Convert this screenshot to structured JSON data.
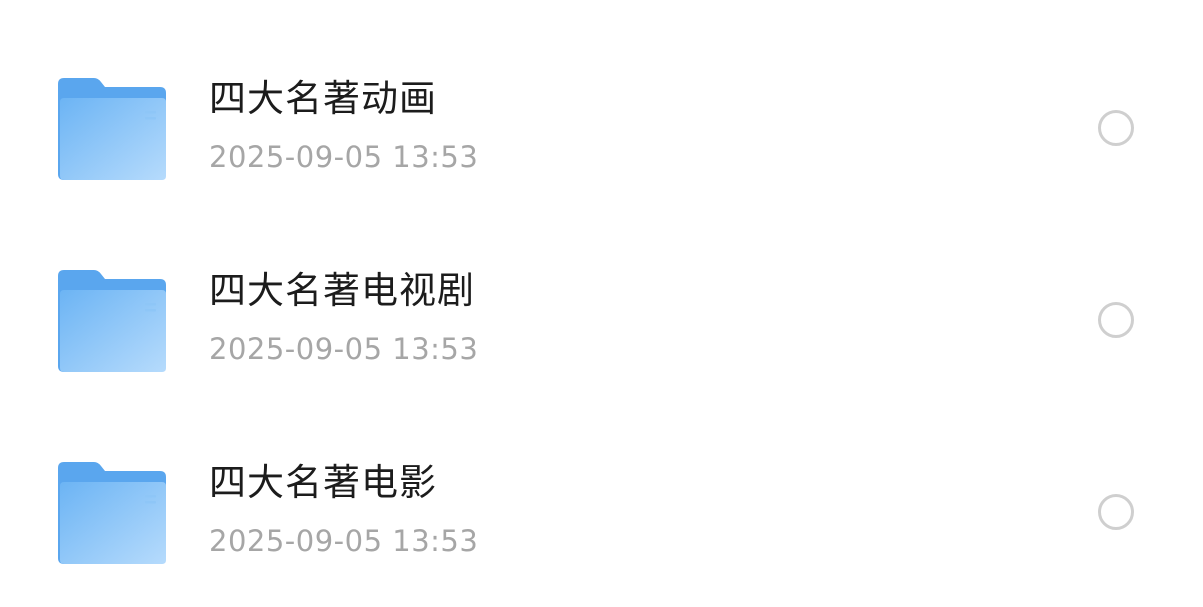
{
  "file_list": {
    "items": [
      {
        "name": "四大名著动画",
        "date": "2025-09-05 13:53",
        "icon": "folder-icon",
        "selected": false
      },
      {
        "name": "四大名著电视剧",
        "date": "2025-09-05 13:53",
        "icon": "folder-icon",
        "selected": false
      },
      {
        "name": "四大名著电影",
        "date": "2025-09-05 13:53",
        "icon": "folder-icon",
        "selected": false
      }
    ]
  },
  "colors": {
    "folder_back": "#5aa9f0",
    "folder_front_start": "#74baf5",
    "folder_front_end": "#b3d9fb",
    "title_text": "#1c1c1c",
    "date_text": "#a6a6a6",
    "radio_border": "#cfcfcf"
  }
}
